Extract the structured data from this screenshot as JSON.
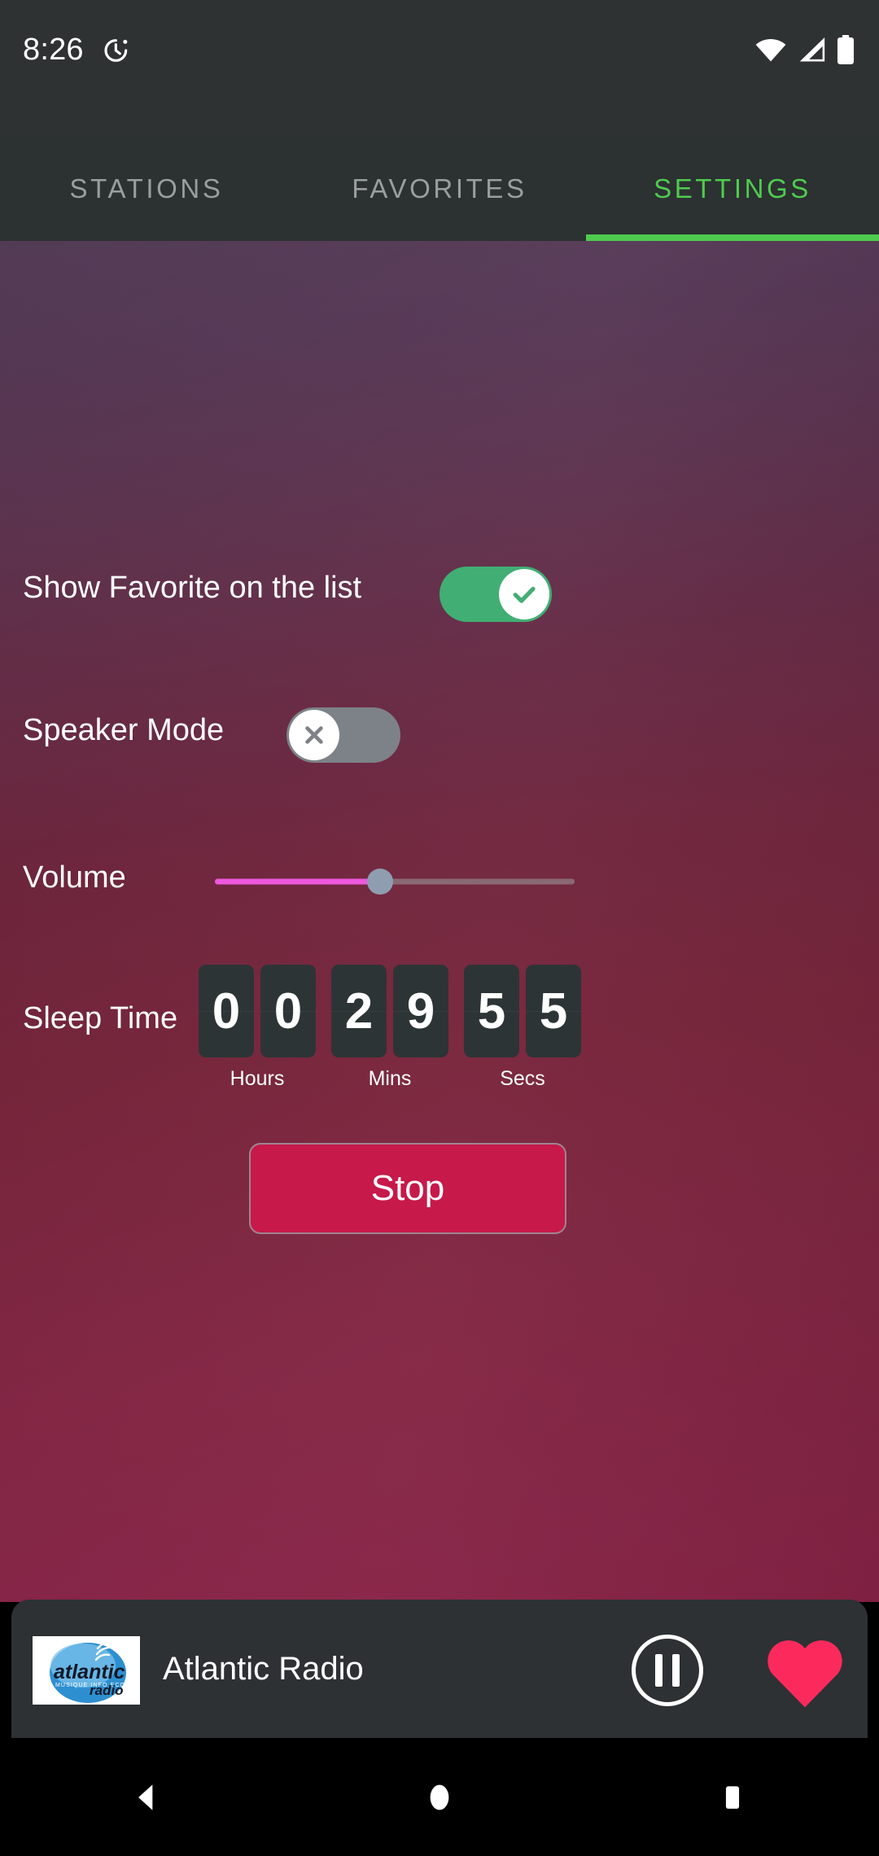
{
  "status_bar": {
    "time": "8:26",
    "alarm_icon": "alarm-clock-icon",
    "wifi_icon": "wifi-icon",
    "signal_icon": "cellular-signal-icon",
    "battery_icon": "battery-full-icon"
  },
  "tabs": [
    {
      "label": "STATIONS",
      "active": false
    },
    {
      "label": "FAVORITES",
      "active": false
    },
    {
      "label": "SETTINGS",
      "active": true
    }
  ],
  "settings": {
    "show_favorite": {
      "label": "Show Favorite on the list",
      "state": "on",
      "knob_icon": "check-icon"
    },
    "speaker_mode": {
      "label": "Speaker Mode",
      "state": "off",
      "knob_icon": "close-x-icon"
    },
    "volume": {
      "label": "Volume",
      "value": 46,
      "min": 0,
      "max": 100
    },
    "sleep_time": {
      "label": "Sleep Time",
      "groups": [
        {
          "unit": "Hours",
          "digits": [
            "0",
            "0"
          ]
        },
        {
          "unit": "Mins",
          "digits": [
            "2",
            "9"
          ]
        },
        {
          "unit": "Secs",
          "digits": [
            "5",
            "5"
          ]
        }
      ]
    },
    "stop_button": "Stop"
  },
  "player": {
    "station_name": "Atlantic Radio",
    "logo_text_main": "atlantic",
    "logo_text_sub": "radio",
    "logo_tagline": "MUSIQUE INFO ECO",
    "play_state_icon": "pause-icon",
    "favorite_icon": "heart-filled-icon"
  },
  "nav_bar": {
    "back_icon": "back-triangle-icon",
    "home_icon": "home-circle-icon",
    "recents_icon": "recents-square-icon"
  },
  "colors": {
    "accent_green": "#4ECB4E",
    "toggle_on": "#41AE74",
    "toggle_off": "#7D8288",
    "slider_fill": "#EE58DE",
    "stop_button": "#C7194A",
    "heart": "#FC2A5C",
    "status_bar_bg": "#2E3232",
    "player_bar_bg": "#2D3133"
  }
}
